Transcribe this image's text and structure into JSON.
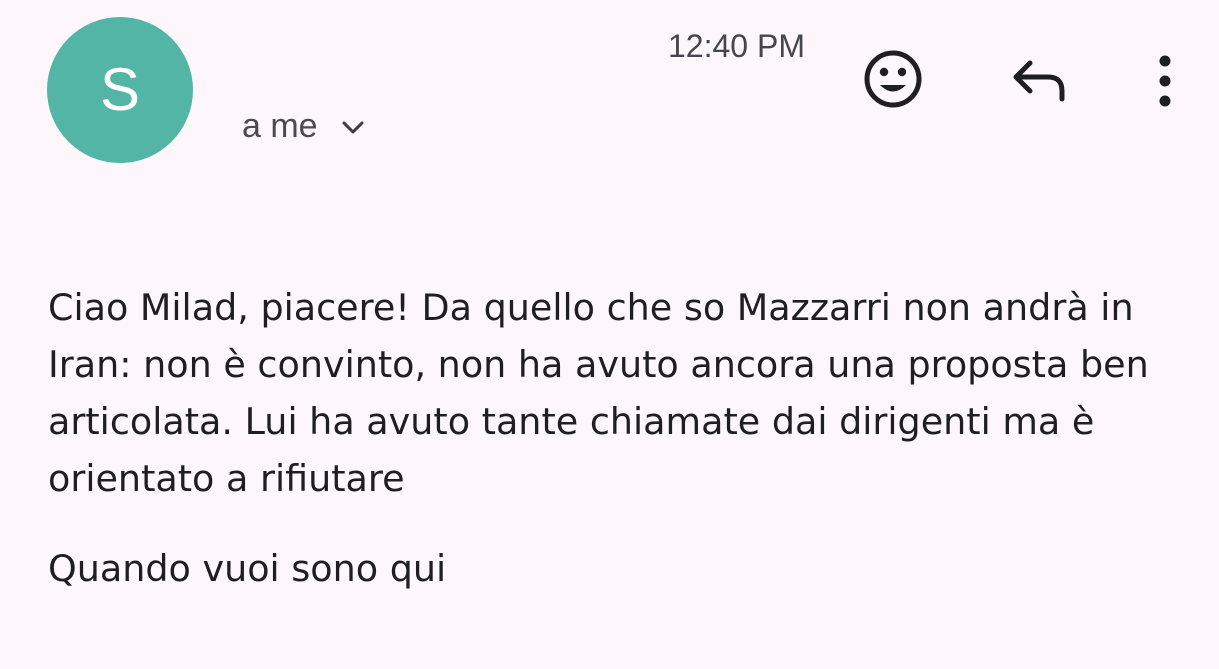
{
  "header": {
    "avatar_letter": "S",
    "avatar_color": "#52b5a6",
    "recipient_label": "a me",
    "time": "12:40 PM",
    "icons": {
      "details": "chevron-down-icon",
      "emoji": "smiley-icon",
      "reply": "reply-icon",
      "more": "more-vert-icon"
    }
  },
  "message": {
    "paragraphs": [
      "Ciao Milad, piacere! Da quello che so Mazzarri non andrà in Iran: non è convinto, non ha avuto ancora una proposta ben articolata. Lui ha avuto tante chiamate dai dirigenti ma è orientato a rifiutare",
      "Quando vuoi sono qui"
    ]
  }
}
